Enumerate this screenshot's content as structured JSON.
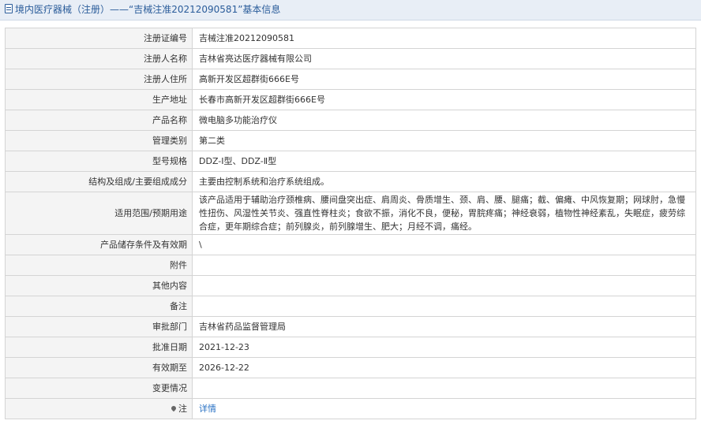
{
  "header": {
    "title": "境内医疗器械（注册）——“吉械注准20212090581”基本信息"
  },
  "rows": [
    {
      "label": "注册证编号",
      "value": "吉械注准20212090581"
    },
    {
      "label": "注册人名称",
      "value": "吉林省亮达医疗器械有限公司"
    },
    {
      "label": "注册人住所",
      "value": "高新开发区超群街666E号"
    },
    {
      "label": "生产地址",
      "value": "长春市高新开发区超群街666E号"
    },
    {
      "label": "产品名称",
      "value": "微电脑多功能治疗仪"
    },
    {
      "label": "管理类别",
      "value": "第二类"
    },
    {
      "label": "型号规格",
      "value": "DDZ-Ⅰ型、DDZ-Ⅱ型"
    },
    {
      "label": "结构及组成/主要组成成分",
      "value": "主要由控制系统和治疗系统组成。"
    },
    {
      "label": "适用范围/预期用途",
      "value": "该产品适用于辅助治疗颈椎病、腰间盘突出症、肩周炎、骨质增生、颈、肩、腰、腿痛；截、偏瘫、中风恢复期；网球肘，急慢性扭伤、风湿性关节炎、强直性脊柱炎；食欲不振，消化不良，便秘，胃脘疼痛；神经衰弱，植物性神经紊乱，失眠症，疲劳综合症，更年期综合症；前列腺炎，前列腺增生、肥大；月经不调，痛经。"
    },
    {
      "label": "产品储存条件及有效期",
      "value": "\\"
    },
    {
      "label": "附件",
      "value": ""
    },
    {
      "label": "其他内容",
      "value": ""
    },
    {
      "label": "备注",
      "value": ""
    },
    {
      "label": "审批部门",
      "value": "吉林省药品监督管理局"
    },
    {
      "label": "批准日期",
      "value": "2021-12-23"
    },
    {
      "label": "有效期至",
      "value": "2026-12-22"
    },
    {
      "label": "变更情况",
      "value": ""
    },
    {
      "label": "注",
      "value": "详情"
    }
  ],
  "icons": {
    "header": "document-icon",
    "note": "pin-icon"
  },
  "colors": {
    "header_bg": "#e8eef6",
    "header_text": "#2a5c9a",
    "label_bg": "#f4f4f4",
    "link": "#2a72c4",
    "border": "#d4d4d4"
  }
}
